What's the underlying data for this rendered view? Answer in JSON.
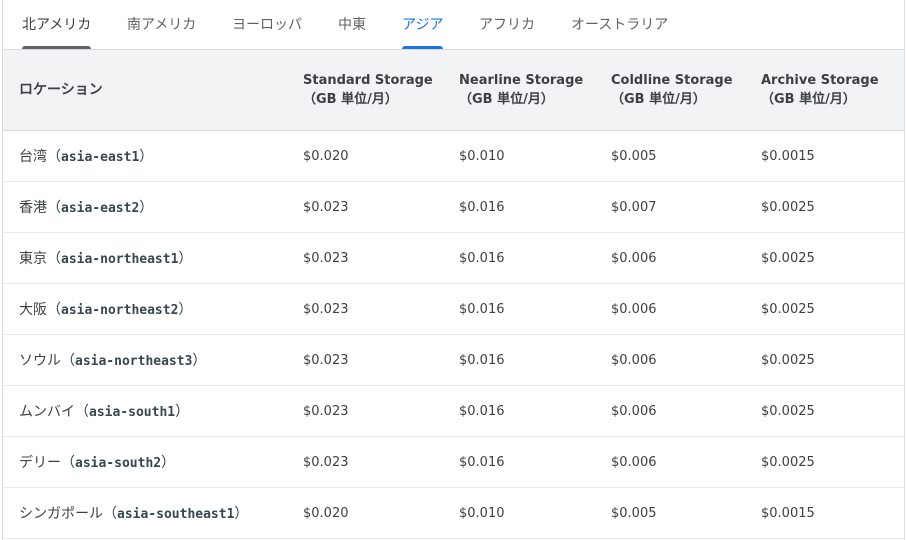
{
  "tabs": [
    {
      "label": "北アメリカ"
    },
    {
      "label": "南アメリカ"
    },
    {
      "label": "ヨーロッパ"
    },
    {
      "label": "中東"
    },
    {
      "label": "アジア"
    },
    {
      "label": "アフリカ"
    },
    {
      "label": "オーストラリア"
    }
  ],
  "active_tab": "アジア",
  "table": {
    "headers": {
      "location": "ロケーション",
      "standard": {
        "name": "Standard Storage",
        "unit": "（GB 単位/月）"
      },
      "nearline": {
        "name": "Nearline Storage",
        "unit": "（GB 単位/月）"
      },
      "coldline": {
        "name": "Coldline Storage",
        "unit": "（GB 単位/月）"
      },
      "archive": {
        "name": "Archive Storage",
        "unit": "（GB 単位/月）"
      }
    },
    "rows": [
      {
        "city": "台湾",
        "open": "（",
        "region": "asia-east1",
        "close": "）",
        "standard": "$0.020",
        "nearline": "$0.010",
        "coldline": "$0.005",
        "archive": "$0.0015"
      },
      {
        "city": "香港",
        "open": "（",
        "region": "asia-east2",
        "close": "）",
        "standard": "$0.023",
        "nearline": "$0.016",
        "coldline": "$0.007",
        "archive": "$0.0025"
      },
      {
        "city": "東京",
        "open": "（",
        "region": "asia-northeast1",
        "close": "）",
        "standard": "$0.023",
        "nearline": "$0.016",
        "coldline": "$0.006",
        "archive": "$0.0025"
      },
      {
        "city": "大阪",
        "open": "（",
        "region": "asia-northeast2",
        "close": "）",
        "standard": "$0.023",
        "nearline": "$0.016",
        "coldline": "$0.006",
        "archive": "$0.0025"
      },
      {
        "city": "ソウル",
        "open": "（",
        "region": "asia-northeast3",
        "close": "）",
        "standard": "$0.023",
        "nearline": "$0.016",
        "coldline": "$0.006",
        "archive": "$0.0025"
      },
      {
        "city": "ムンバイ",
        "open": "（",
        "region": "asia-south1",
        "close": "）",
        "standard": "$0.023",
        "nearline": "$0.016",
        "coldline": "$0.006",
        "archive": "$0.0025"
      },
      {
        "city": "デリー",
        "open": "（",
        "region": "asia-south2",
        "close": "）",
        "standard": "$0.023",
        "nearline": "$0.016",
        "coldline": "$0.006",
        "archive": "$0.0025"
      },
      {
        "city": "シンガポール",
        "open": "（",
        "region": "asia-southeast1",
        "close": "）",
        "standard": "$0.020",
        "nearline": "$0.010",
        "coldline": "$0.005",
        "archive": "$0.0015"
      }
    ]
  },
  "colors": {
    "active_tab": "#1a73e8",
    "header_bg": "#f1f3f4",
    "divider": "#dadce0"
  }
}
